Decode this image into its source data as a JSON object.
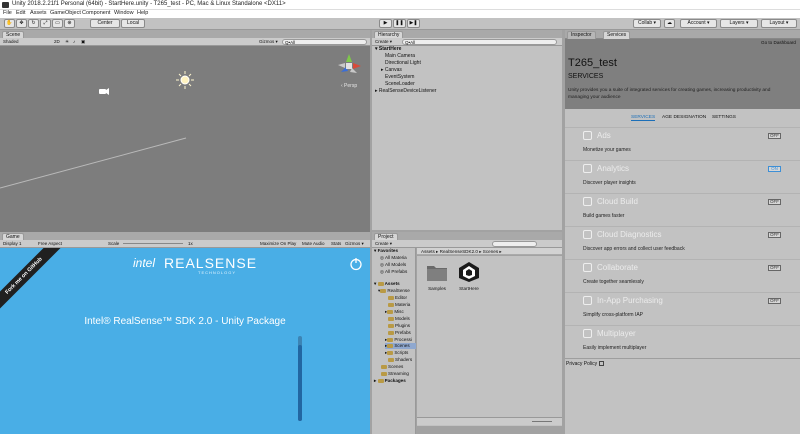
{
  "window": {
    "title": "Unity 2018.2.21f1 Personal (64bit) - StartHere.unity - T265_test - PC, Mac & Linux Standalone <DX11>"
  },
  "menu": [
    "File",
    "Edit",
    "Assets",
    "GameObject",
    "Component",
    "Window",
    "Help"
  ],
  "toolbar": {
    "pivot_label": "Center",
    "space_label": "Local",
    "collab_label": "Collab ▾",
    "account_label": "Account ▾",
    "layers_label": "Layers ▾",
    "layout_label": "Layout ▾"
  },
  "scene": {
    "tab_label": "Scene",
    "shading": "Shaded",
    "mode_2d": "2D",
    "gizmos": "Gizmos ▾",
    "search_placeholder": "Q•All",
    "persp_label": "‹ Persp"
  },
  "game": {
    "tab_label": "Game",
    "display": "Display 1",
    "aspect": "Free Aspect",
    "scale_label": "Scale",
    "scale_value": "1x",
    "maximize": "Maximize On Play",
    "mute": "Mute Audio",
    "stats": "Stats",
    "gizmos": "Gizmos ▾",
    "github_banner": "Fork me on GitHub",
    "logo_intel": "intel",
    "logo_realsense": "REALSENSE",
    "logo_sub": "TECHNOLOGY",
    "headline": "Intel® RealSense™ SDK 2.0 - Unity Package",
    "slider_level": 0.9
  },
  "hierarchy": {
    "tab_label": "Hierarchy",
    "create_label": "Create ▾",
    "search_placeholder": "Q•All",
    "scene_name": "StartHere",
    "items": [
      "Main Camera",
      "Directional Light",
      "Canvas",
      "EventSystem",
      "SceneLoader"
    ],
    "extra_root": "RealSenseDeviceListener"
  },
  "project": {
    "tab_label": "Project",
    "create_label": "Create ▾",
    "favorites": "Favorites",
    "fav_items": [
      "All Materia",
      "All Models",
      "All Prefabs"
    ],
    "assets": "Assets",
    "tree": [
      "RealSense",
      "Editor",
      "Materia",
      "Misc",
      "Models",
      "Plugins",
      "Prefabs",
      "Processi",
      "Scenes",
      "Scripts",
      "Shaders",
      "Scenes",
      "Streaming"
    ],
    "packages": "Packages",
    "breadcrumb": "Assets ▸ RealSenseSDK2.0 ▸ Scenes ▸",
    "files": [
      "Samples",
      "StartHere"
    ]
  },
  "inspector": {
    "tab_inspector": "Inspector",
    "tab_services": "Services",
    "goto_dashboard": "Go to Dashboard",
    "project_name": "T265_test",
    "services_heading": "SERVICES",
    "intro": "Unity provides you a suite of integrated services for creating games, increasing productivity and managing your audience",
    "subtabs": [
      "SERVICES",
      "AGE DESIGNATION",
      "SETTINGS"
    ],
    "services": [
      {
        "name": "Ads",
        "desc": "Monetize your games",
        "state": "OFF"
      },
      {
        "name": "Analytics",
        "desc": "Discover player insights",
        "state": "ON"
      },
      {
        "name": "Cloud Build",
        "desc": "Build games faster",
        "state": "OFF"
      },
      {
        "name": "Cloud Diagnostics",
        "desc": "Discover app errors and collect user feedback",
        "state": "OFF"
      },
      {
        "name": "Collaborate",
        "desc": "Create together seamlessly",
        "state": "OFF"
      },
      {
        "name": "In-App Purchasing",
        "desc": "Simplify cross-platform IAP",
        "state": "OFF"
      },
      {
        "name": "Multiplayer",
        "desc": "Easily implement multiplayer",
        "state": ""
      }
    ],
    "privacy": "Privacy Policy"
  },
  "colors": {
    "game_bg": "#49aee6",
    "scene_bg": "#7d7d7d",
    "panel_bg": "#c2c2c2",
    "services_header": "#7f7f7f",
    "analytics_on": "#3d8fd6"
  }
}
